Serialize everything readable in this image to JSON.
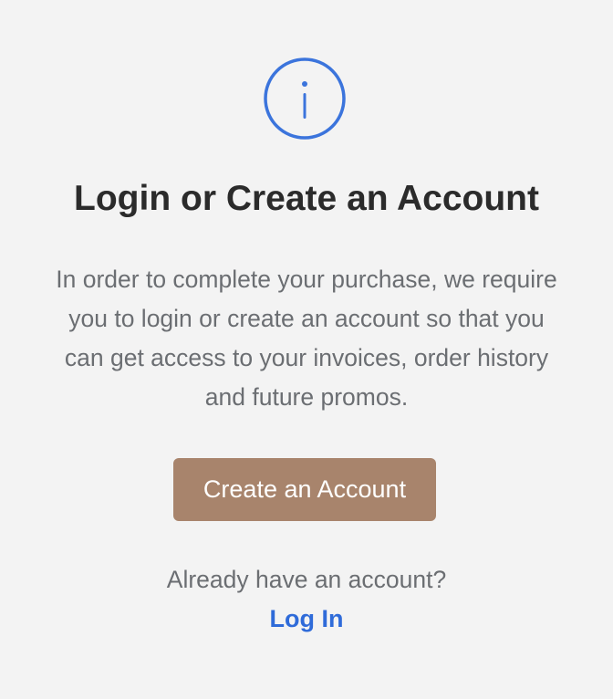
{
  "icon": {
    "name": "info-icon",
    "color": "#3b74dc"
  },
  "dialog": {
    "title": "Login or Create an Account",
    "description": "In order to complete your purchase, we require you to login or create an account so that you can get access to your invoices, order history and future promos.",
    "create_button_label": "Create an Account",
    "existing_account_prompt": "Already have an account?",
    "login_link_label": "Log In"
  },
  "colors": {
    "button_background": "#a8846c",
    "link": "#2f6bd9",
    "title": "#2b2b2b",
    "body_text": "#6b6e72",
    "background": "#f3f3f3"
  }
}
